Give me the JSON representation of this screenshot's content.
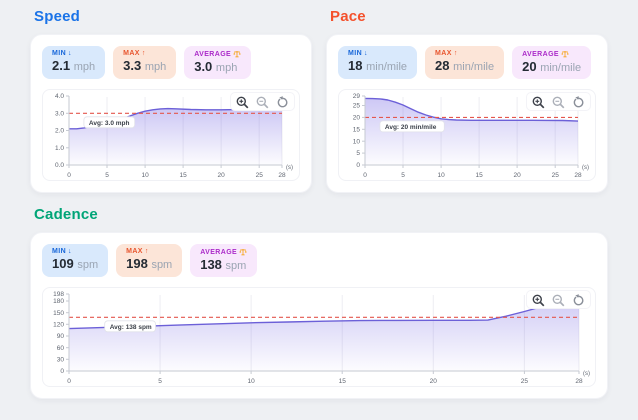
{
  "page": {
    "background": "#eef0f3"
  },
  "panels": [
    {
      "title": "Speed",
      "accent": "#1a73e8",
      "stats": {
        "min": {
          "label": "MIN",
          "icon": "↓",
          "value": "2.1",
          "unit": "mph"
        },
        "max": {
          "label": "MAX",
          "icon": "↑",
          "value": "3.3",
          "unit": "mph"
        },
        "average": {
          "label": "AVERAGE",
          "value": "3.0",
          "unit": "mph"
        }
      }
    },
    {
      "title": "Pace",
      "accent": "#f4512c",
      "stats": {
        "min": {
          "label": "MIN",
          "icon": "↓",
          "value": "18",
          "unit": "min/mile"
        },
        "max": {
          "label": "MAX",
          "icon": "↑",
          "value": "28",
          "unit": "min/mile"
        },
        "average": {
          "label": "AVERAGE",
          "value": "20",
          "unit": "min/mile"
        }
      }
    },
    {
      "title": "Cadence",
      "accent": "#00a577",
      "stats": {
        "min": {
          "label": "MIN",
          "icon": "↓",
          "value": "109",
          "unit": "spm"
        },
        "max": {
          "label": "MAX",
          "icon": "↑",
          "value": "198",
          "unit": "spm"
        },
        "average": {
          "label": "AVERAGE",
          "value": "138",
          "unit": "spm"
        }
      }
    }
  ],
  "chart_data": [
    {
      "type": "area",
      "title": "Speed",
      "x": [
        0,
        1,
        2,
        3,
        4,
        5,
        6,
        7,
        8,
        9,
        10,
        11,
        12,
        13,
        14,
        16,
        18,
        20,
        22,
        24,
        26,
        28
      ],
      "y": [
        2.1,
        2.1,
        2.15,
        2.25,
        2.35,
        2.4,
        2.52,
        2.67,
        2.84,
        3.0,
        3.12,
        3.2,
        3.25,
        3.27,
        3.26,
        3.22,
        3.2,
        3.2,
        3.21,
        3.22,
        3.23,
        3.26
      ],
      "avg": 3.0,
      "avg_label": "Avg: 3.0 mph",
      "xlim": [
        0,
        28
      ],
      "ylim": [
        0,
        4
      ],
      "ytick_values": [
        0,
        1,
        2,
        3,
        4
      ],
      "ytick_labels": [
        "0.0",
        "1.0",
        "2.0",
        "3.0",
        "4.0"
      ],
      "xticks": [
        0,
        5,
        10,
        15,
        20,
        25,
        28
      ],
      "xunit": "(s)",
      "grid": "vertical",
      "legend": "none"
    },
    {
      "type": "area",
      "title": "Pace",
      "x": [
        0,
        1,
        2,
        3,
        4,
        5,
        6,
        7,
        8,
        9,
        10,
        11,
        12,
        14,
        16,
        18,
        20,
        22,
        24,
        26,
        28
      ],
      "y": [
        28,
        27.9,
        27.8,
        27.3,
        26.4,
        25.2,
        23.7,
        22.2,
        21.0,
        20.1,
        19.4,
        19.1,
        18.9,
        18.8,
        18.8,
        18.8,
        18.8,
        18.8,
        18.75,
        18.7,
        18.45
      ],
      "avg": 20,
      "avg_label": "Avg: 20 min/mile",
      "xlim": [
        0,
        28
      ],
      "ylim": [
        0,
        29
      ],
      "ytick_values": [
        0,
        5,
        10,
        15,
        20,
        25,
        29
      ],
      "ytick_labels": [
        "0",
        "5",
        "10",
        "15",
        "20",
        "25",
        "29"
      ],
      "xticks": [
        0,
        5,
        10,
        15,
        20,
        25,
        28
      ],
      "xunit": "(s)",
      "grid": "vertical",
      "legend": "none"
    },
    {
      "type": "area",
      "title": "Cadence",
      "x": [
        0,
        2,
        4,
        6,
        8,
        10,
        12,
        14,
        16,
        18,
        20,
        22,
        23,
        24,
        25,
        26,
        27,
        28
      ],
      "y": [
        109,
        112,
        115,
        118,
        121,
        124,
        126,
        128,
        129.5,
        130,
        130.5,
        130.5,
        131,
        141,
        153,
        166,
        181,
        198
      ],
      "avg": 138,
      "avg_label": "Avg: 138 spm",
      "xlim": [
        0,
        28
      ],
      "ylim": [
        0,
        198
      ],
      "ytick_values": [
        0,
        30,
        60,
        90,
        120,
        150,
        180,
        198
      ],
      "ytick_labels": [
        "0",
        "30",
        "60",
        "90",
        "120",
        "150",
        "180",
        "198"
      ],
      "xticks": [
        0,
        5,
        10,
        15,
        20,
        25,
        28
      ],
      "xunit": "(s)",
      "grid": "vertical",
      "legend": "none"
    }
  ],
  "colors": {
    "line": "#6c60d8",
    "area_top": "rgba(124,110,228,0.38)",
    "area_bottom": "rgba(124,110,228,0.02)",
    "avg_line": "#e4574e",
    "axis": "#c6cad2",
    "grid": "#ededf2",
    "tick_text": "#5f6570",
    "avg_label_text": "#3b4049",
    "avg_label_border": "#e1e2e9"
  }
}
